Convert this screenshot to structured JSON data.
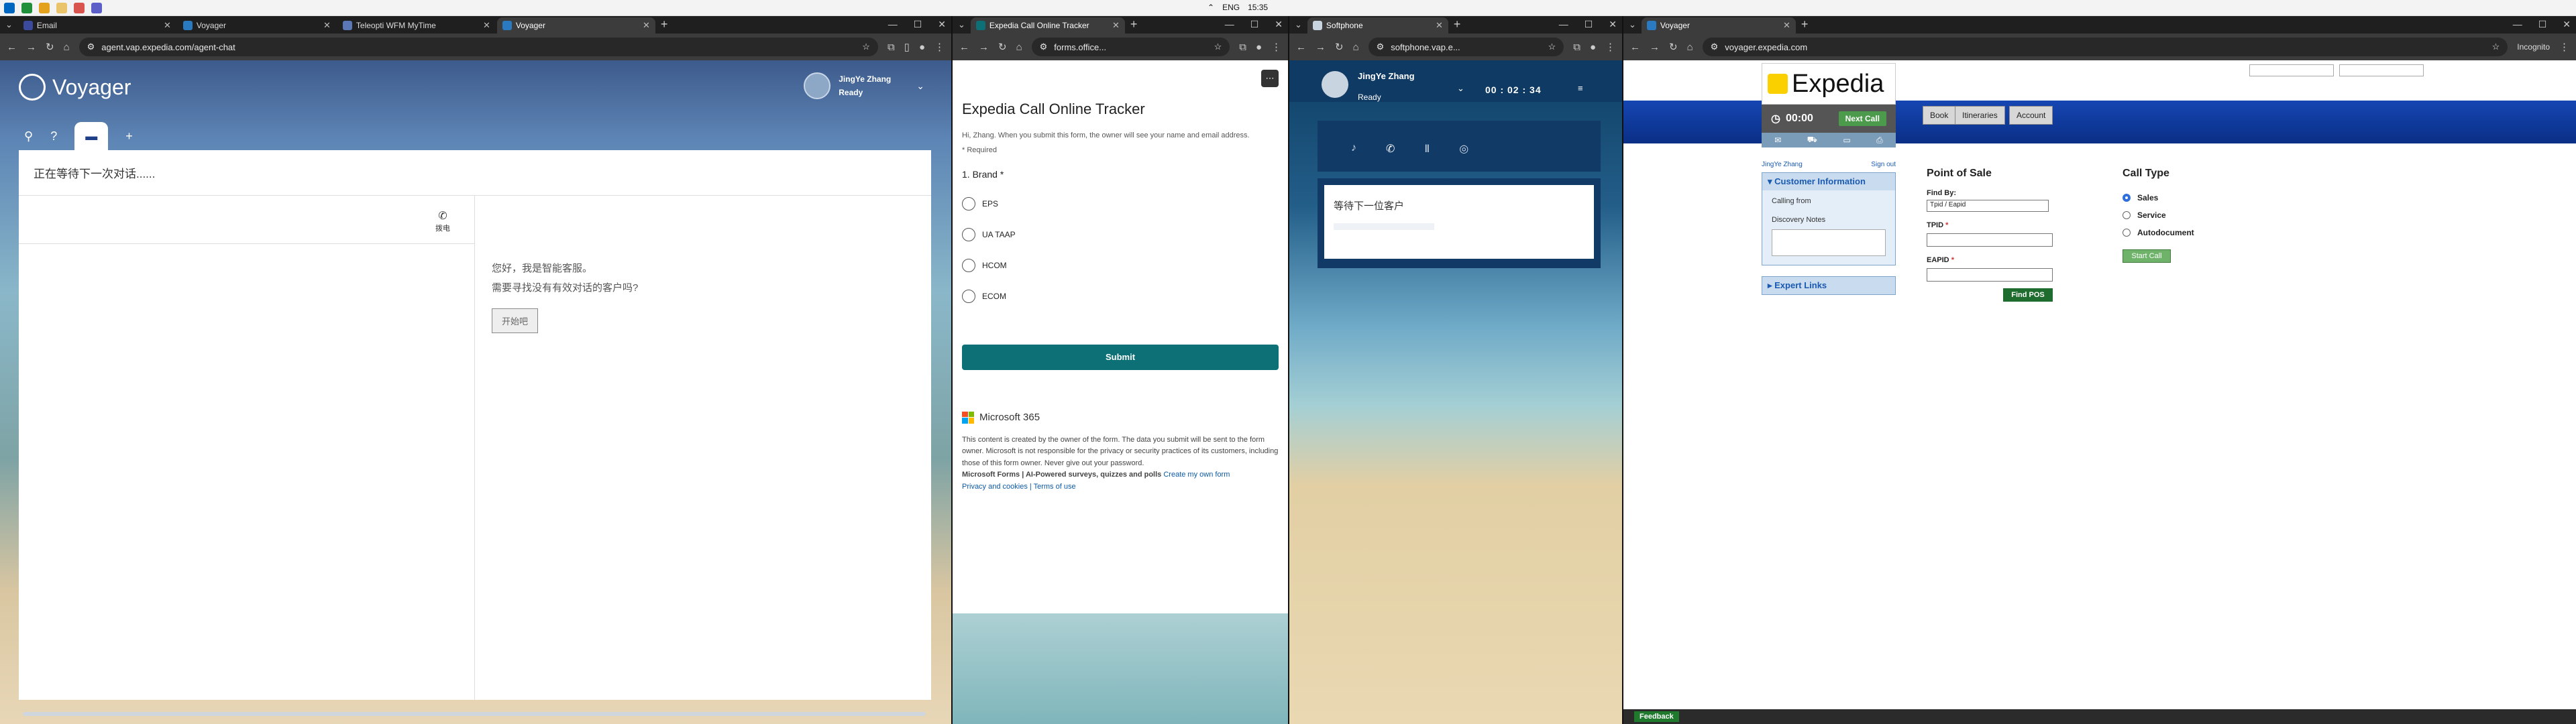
{
  "os": {
    "lang": "ENG",
    "time": "15:35"
  },
  "w1": {
    "tabs": [
      {
        "label": "Email",
        "color": "#3b4a9c"
      },
      {
        "label": "Voyager",
        "color": "#2a7ac2"
      },
      {
        "label": "Teleopti WFM MyTime",
        "color": "#5a78b5"
      },
      {
        "label": "Voyager",
        "color": "#2a7ac2"
      }
    ],
    "url": "agent.vap.expedia.com/agent-chat",
    "brand": "Voyager",
    "user_name": "JingYe Zhang",
    "user_status": "Ready",
    "waiting": "正在等待下一次对话......",
    "dial_label": "拨电",
    "greet1": "您好，我是智能客服。",
    "greet2": "需要寻找没有有效对话的客户吗?",
    "start_btn": "开始吧"
  },
  "w2": {
    "tab": "Expedia Call Online Tracker",
    "url": "forms.office...",
    "title": "Expedia Call Online Tracker",
    "intro": "Hi, Zhang. When you submit this form, the owner will see your name and email address.",
    "required": "* Required",
    "question": "1. Brand *",
    "options": [
      "EPS",
      "UA TAAP",
      "HCOM",
      "ECOM"
    ],
    "submit": "Submit",
    "ms": "Microsoft 365",
    "footer": "This content is created by the owner of the form. The data you submit will be sent to the form owner. Microsoft is not responsible for the privacy or security practices of its customers, including those of this form owner. Never give out your password.",
    "forms_line": "Microsoft Forms | AI-Powered surveys, quizzes and polls",
    "create_link": "Create my own form",
    "privacy": "Privacy and cookies | Terms of use"
  },
  "w3": {
    "tab": "Softphone",
    "url": "softphone.vap.e...",
    "name": "JingYe Zhang",
    "status": "Ready",
    "timer": "00 : 02 : 34",
    "waiting": "等待下一位客户"
  },
  "w4": {
    "tab": "Voyager",
    "url": "voyager.expedia.com",
    "incognito": "Incognito",
    "logo": "Expedia",
    "timer": "00:00",
    "next_call": "Next Call",
    "nav": [
      "Book",
      "Itineraries",
      "Account"
    ],
    "user": "JingYe Zhang",
    "signout": "Sign out",
    "cust_info": "Customer Information",
    "calling_from": "Calling from",
    "discovery": "Discovery Notes",
    "expert": "Expert Links",
    "pos_title": "Point of Sale",
    "find_by": "Find By:",
    "find_by_value": "Tpid / Eapid",
    "tpid": "TPID",
    "eapid": "EAPID",
    "find_pos": "Find POS",
    "call_type": "Call Type",
    "call_types": [
      "Sales",
      "Service",
      "Autodocument"
    ],
    "start_call": "Start Call",
    "feedback": "Feedback"
  }
}
